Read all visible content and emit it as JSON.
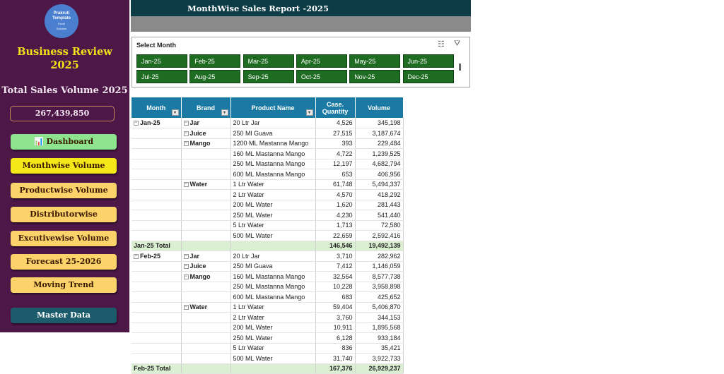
{
  "logo": {
    "line1": "Prakruti",
    "line2": "Template",
    "line3": "Excel",
    "line4": "Solution"
  },
  "sidebar": {
    "title_line1": "Business Review",
    "title_line2": "2025",
    "total_label": "Total Sales Volume 2025",
    "total_value": "267,439,850",
    "buttons": [
      {
        "label": "Dashboard",
        "color": "#8ee48e"
      },
      {
        "label": "Monthwise Volume",
        "color": "#f5e81a"
      },
      {
        "label": "Productwise Volume",
        "color": "#fcd26a"
      },
      {
        "label": "Distributorwise",
        "color": "#fcd26a"
      },
      {
        "label": "Excutivewise Volume",
        "color": "#fcd26a"
      },
      {
        "label": "Forecast 25-2026",
        "color": "#fcd26a"
      },
      {
        "label": "Moving Trend",
        "color": "#fcd26a"
      },
      {
        "label": "Master Data",
        "color": "#1b5b6b"
      }
    ]
  },
  "header": {
    "title": "MonthWise Sales Report -2025"
  },
  "slicer": {
    "title": "Select Month",
    "months": [
      "Jan-25",
      "Feb-25",
      "Mar-25",
      "Apr-25",
      "May-25",
      "Jun-25",
      "Jul-25",
      "Aug-25",
      "Sep-25",
      "Oct-25",
      "Nov-25",
      "Dec-25"
    ]
  },
  "table": {
    "headers": [
      "Month",
      "Brand",
      "Product Name",
      "Case. Quantity",
      "Volume"
    ],
    "rows": [
      [
        "Jan-25",
        "Jar",
        "20 Ltr Jar",
        "4,526",
        "345,198"
      ],
      [
        "",
        "Juice",
        "250 Ml Guava",
        "27,515",
        "3,187,674"
      ],
      [
        "",
        "Mango",
        "1200 ML Mastanna Mango",
        "393",
        "229,484"
      ],
      [
        "",
        "",
        "160 ML Mastanna Mango",
        "4,722",
        "1,239,525"
      ],
      [
        "",
        "",
        "250 ML Mastanna Mango",
        "12,197",
        "4,682,794"
      ],
      [
        "",
        "",
        "600 ML Mastanna Mango",
        "653",
        "406,956"
      ],
      [
        "",
        "Water",
        "1 Ltr Water",
        "61,748",
        "5,494,337"
      ],
      [
        "",
        "",
        "2 Ltr Water",
        "4,570",
        "418,292"
      ],
      [
        "",
        "",
        "200 ML Water",
        "1,620",
        "281,443"
      ],
      [
        "",
        "",
        "250 ML Water",
        "4,230",
        "541,440"
      ],
      [
        "",
        "",
        "5 Ltr Water",
        "1,713",
        "72,580"
      ],
      [
        "",
        "",
        "500 ML Water",
        "22,659",
        "2,592,416"
      ],
      [
        "Jan-25 Total",
        "",
        "",
        "146,546",
        "19,492,139"
      ],
      [
        "Feb-25",
        "Jar",
        "20 Ltr Jar",
        "3,710",
        "282,962"
      ],
      [
        "",
        "Juice",
        "250 Ml Guava",
        "7,412",
        "1,146,059"
      ],
      [
        "",
        "Mango",
        "160 ML Mastanna Mango",
        "32,564",
        "8,577,738"
      ],
      [
        "",
        "",
        "250 ML Mastanna Mango",
        "10,228",
        "3,958,898"
      ],
      [
        "",
        "",
        "600 ML Mastanna Mango",
        "683",
        "425,652"
      ],
      [
        "",
        "Water",
        "1 Ltr Water",
        "59,404",
        "5,406,870"
      ],
      [
        "",
        "",
        "2 Ltr Water",
        "3,760",
        "344,153"
      ],
      [
        "",
        "",
        "200 ML Water",
        "10,911",
        "1,895,568"
      ],
      [
        "",
        "",
        "250 ML Water",
        "6,128",
        "933,184"
      ],
      [
        "",
        "",
        "5 Ltr Water",
        "836",
        "35,421"
      ],
      [
        "",
        "",
        "500 ML Water",
        "31,740",
        "3,922,733"
      ],
      [
        "Feb-25 Total",
        "",
        "",
        "167,376",
        "26,929,237"
      ]
    ]
  }
}
